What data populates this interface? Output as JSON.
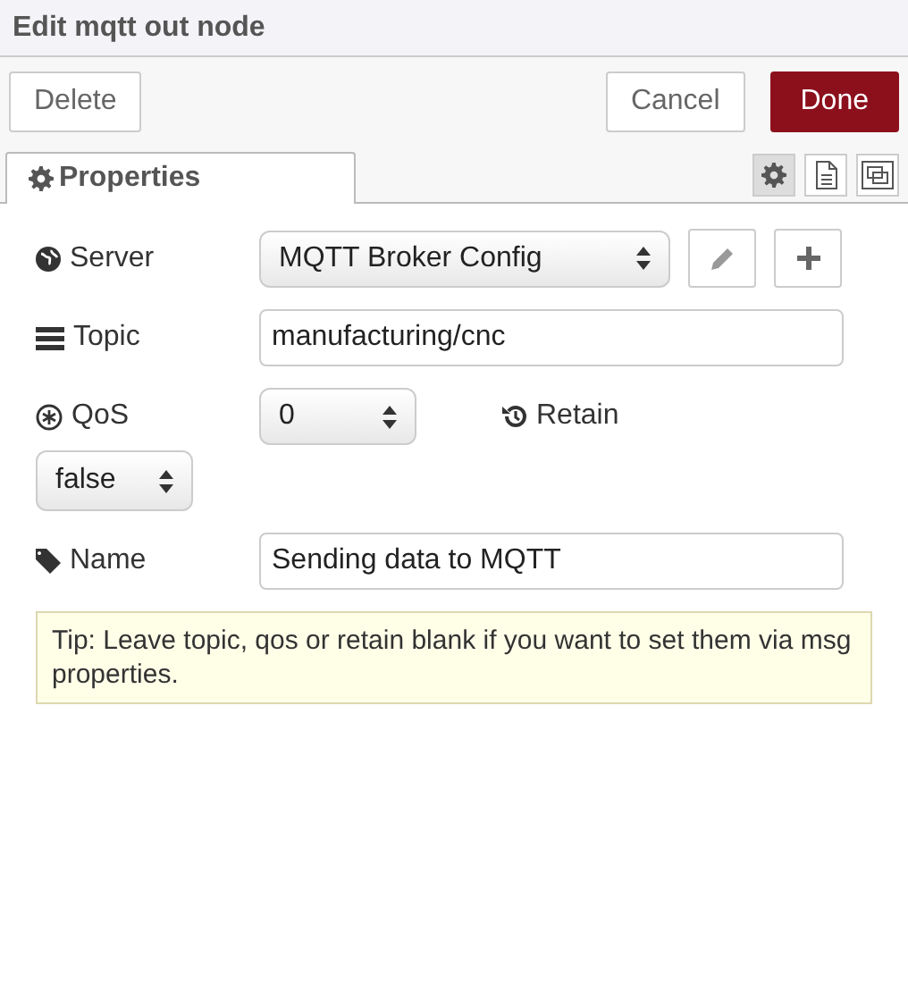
{
  "window": {
    "title": "Edit mqtt out node"
  },
  "buttons": [
    {
      "label": "Delete",
      "kind": "plain"
    },
    {
      "label": "Cancel",
      "kind": "plain"
    },
    {
      "label": "Done",
      "kind": "primary"
    }
  ],
  "tab": {
    "label": "Properties",
    "selected": true
  },
  "side_tabs": [
    {
      "kind": "settings",
      "selected": true
    },
    {
      "kind": "description",
      "selected": false
    },
    {
      "kind": "appearance",
      "selected": false
    }
  ],
  "form": {
    "server": {
      "label": "Server",
      "value": "MQTT Broker Config"
    },
    "topic": {
      "label": "Topic",
      "value": "manufacturing/cnc"
    },
    "qos": {
      "label": "QoS",
      "value": "0"
    },
    "retain": {
      "label": "Retain",
      "value": "false"
    },
    "name": {
      "label": "Name",
      "value": "Sending data to MQTT"
    }
  },
  "tip": "Tip: Leave topic, qos or retain blank if you want to set them via msg properties."
}
